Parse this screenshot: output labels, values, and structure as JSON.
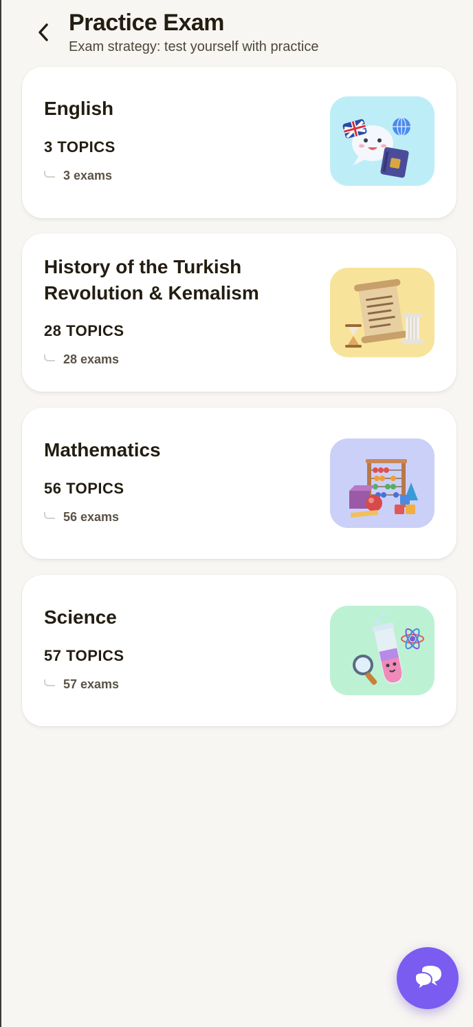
{
  "header": {
    "title": "Practice Exam",
    "subtitle": "Exam strategy: test yourself with practice"
  },
  "subjects": [
    {
      "name": "English",
      "topics": "3 TOPICS",
      "exams": "3 exams",
      "thumb_color": "#bdeef7",
      "icon": "english-illustration-icon"
    },
    {
      "name": "History of the Turkish Revolution & Kemalism",
      "topics": "28 TOPICS",
      "exams": "28 exams",
      "thumb_color": "#f8e39a",
      "icon": "history-scroll-illustration-icon"
    },
    {
      "name": "Mathematics",
      "topics": "56 TOPICS",
      "exams": "56 exams",
      "thumb_color": "#cbd0f8",
      "icon": "math-abacus-illustration-icon"
    },
    {
      "name": "Science",
      "topics": "57 TOPICS",
      "exams": "57 exams",
      "thumb_color": "#bdf1d3",
      "icon": "science-flask-illustration-icon"
    }
  ],
  "colors": {
    "background": "#f8f6f2",
    "card": "#ffffff",
    "accent": "#7a5cf0",
    "text": "#231d12"
  },
  "fab": {
    "icon": "chat-bubbles-icon"
  }
}
